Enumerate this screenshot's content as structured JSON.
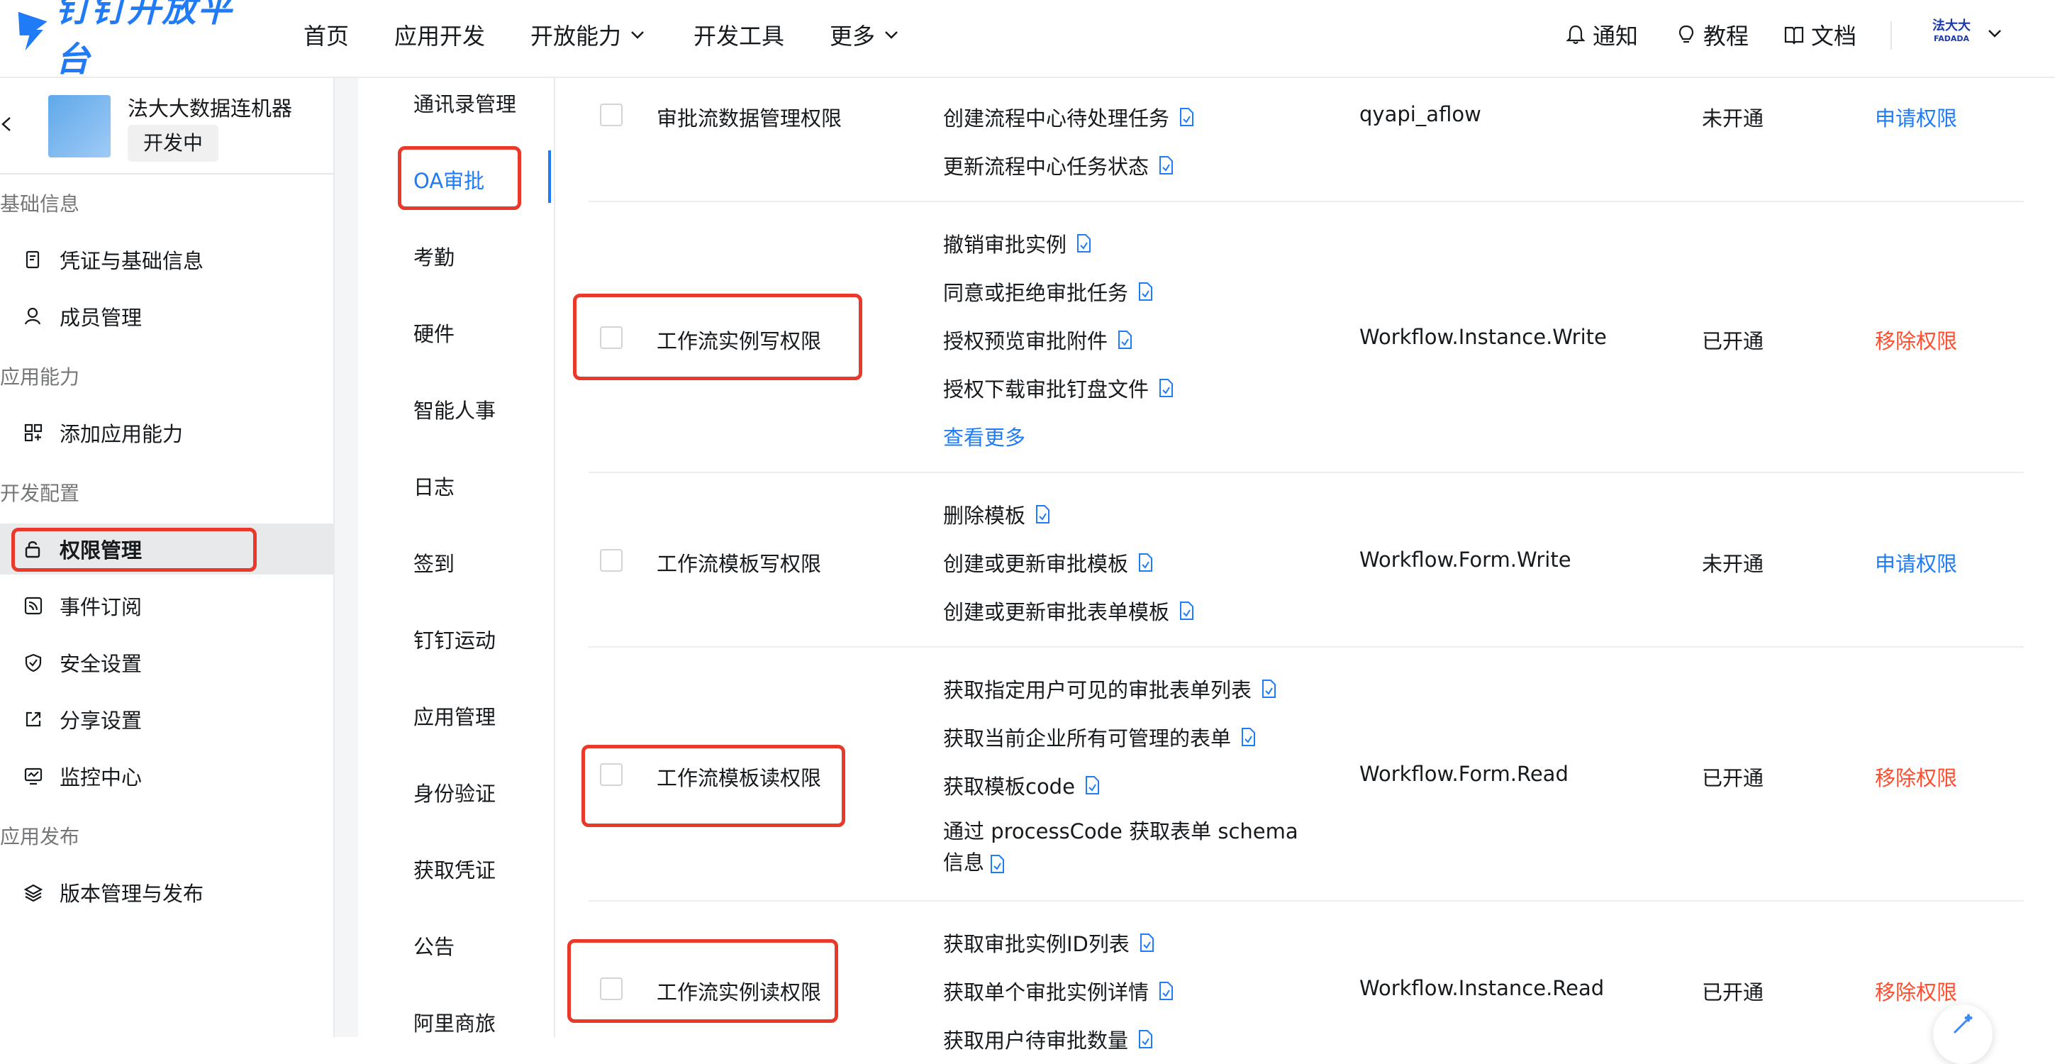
{
  "header": {
    "logo_text": "钉钉开放平台",
    "nav": [
      "首页",
      "应用开发",
      "开放能力",
      "开发工具",
      "更多"
    ],
    "notify": "通知",
    "tutorial": "教程",
    "docs": "文档",
    "brand_line1": "法大大",
    "brand_line2": "FADADA"
  },
  "sidebar": {
    "app_name": "法大大数据连机器",
    "app_status": "开发中",
    "sections": [
      "基础信息",
      "应用能力",
      "开发配置",
      "应用发布"
    ],
    "items": [
      "凭证与基础信息",
      "成员管理",
      "添加应用能力",
      "权限管理",
      "事件订阅",
      "安全设置",
      "分享设置",
      "监控中心",
      "版本管理与发布"
    ]
  },
  "categories": [
    "通讯录管理",
    "OA审批",
    "考勤",
    "硬件",
    "智能人事",
    "日志",
    "签到",
    "钉钉运动",
    "应用管理",
    "身份验证",
    "获取凭证",
    "公告",
    "阿里商旅"
  ],
  "permissions": [
    {
      "name": "审批流数据管理权限",
      "apis": [
        "创建流程中心待处理任务",
        "更新流程中心任务状态"
      ],
      "code": "qyapi_aflow",
      "status": "未开通",
      "action": "申请权限"
    },
    {
      "name": "工作流实例写权限",
      "apis": [
        "撤销审批实例",
        "同意或拒绝审批任务",
        "授权预览审批附件",
        "授权下载审批钉盘文件"
      ],
      "more": "查看更多",
      "code": "Workflow.Instance.Write",
      "status": "已开通",
      "action": "移除权限"
    },
    {
      "name": "工作流模板写权限",
      "apis": [
        "删除模板",
        "创建或更新审批模板",
        "创建或更新审批表单模板"
      ],
      "code": "Workflow.Form.Write",
      "status": "未开通",
      "action": "申请权限"
    },
    {
      "name": "工作流模板读权限",
      "apis": [
        "获取指定用户可见的审批表单列表",
        "获取当前企业所有可管理的表单",
        "获取模板code",
        "通过 processCode 获取表单 schema 信息"
      ],
      "code": "Workflow.Form.Read",
      "status": "已开通",
      "action": "移除权限"
    },
    {
      "name": "工作流实例读权限",
      "apis": [
        "获取审批实例ID列表",
        "获取单个审批实例详情",
        "获取用户待审批数量"
      ],
      "code": "Workflow.Instance.Read",
      "status": "已开通",
      "action": "移除权限"
    }
  ],
  "colors": {
    "accent": "#1f7bf6",
    "remove": "#ff4d2e",
    "highlight": "#e8392b"
  }
}
